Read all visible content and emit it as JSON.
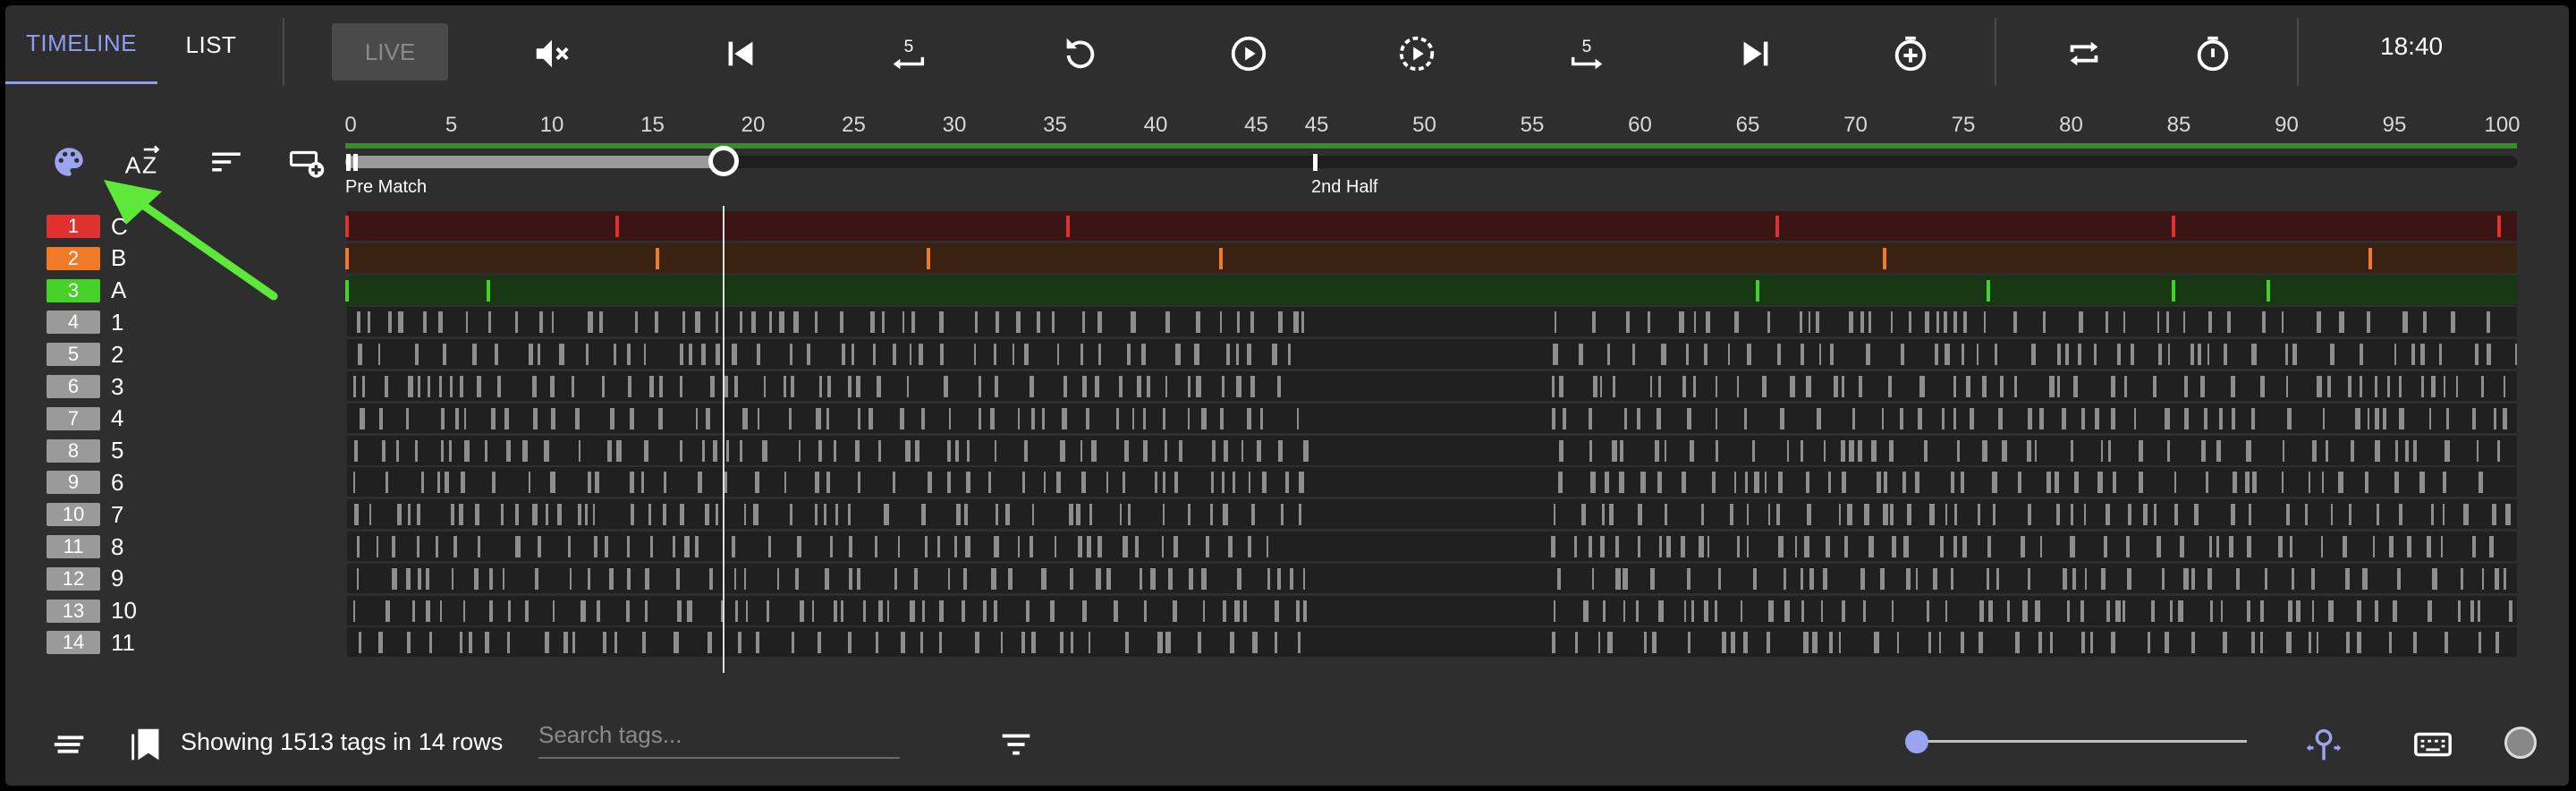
{
  "tabs": {
    "timeline": "TIMELINE",
    "list": "LIST"
  },
  "live_label": "LIVE",
  "clock": "18:40",
  "toolbar_icons": [
    "mute-icon",
    "skip-previous-icon",
    "rewind-5-icon",
    "replay-icon",
    "play-icon",
    "slow-play-icon",
    "forward-5-icon",
    "skip-next-icon",
    "add-timer-icon",
    "loop-icon",
    "timer-icon"
  ],
  "ruler": {
    "ticks_first_half": [
      "0",
      "5",
      "10",
      "15",
      "20",
      "25",
      "30",
      "35",
      "40",
      "45"
    ],
    "ticks_second_half": [
      "45",
      "50",
      "55",
      "60",
      "65",
      "70",
      "75",
      "80",
      "85",
      "90",
      "95",
      "100"
    ]
  },
  "periods": [
    "Pre Match",
    "2nd Half"
  ],
  "playhead_minute": 18.8,
  "rows": [
    {
      "num": "1",
      "name": "C",
      "color": "#e03131",
      "bg": "#3b1414"
    },
    {
      "num": "2",
      "name": "B",
      "color": "#f07a28",
      "bg": "#3a2212"
    },
    {
      "num": "3",
      "name": "A",
      "color": "#46d128",
      "bg": "#173812"
    },
    {
      "num": "4",
      "name": "1",
      "color": "#9a9a9a",
      "bg": "#202020"
    },
    {
      "num": "5",
      "name": "2",
      "color": "#9a9a9a",
      "bg": "#202020"
    },
    {
      "num": "6",
      "name": "3",
      "color": "#9a9a9a",
      "bg": "#202020"
    },
    {
      "num": "7",
      "name": "4",
      "color": "#9a9a9a",
      "bg": "#202020"
    },
    {
      "num": "8",
      "name": "5",
      "color": "#9a9a9a",
      "bg": "#202020"
    },
    {
      "num": "9",
      "name": "6",
      "color": "#9a9a9a",
      "bg": "#202020"
    },
    {
      "num": "10",
      "name": "7",
      "color": "#9a9a9a",
      "bg": "#202020"
    },
    {
      "num": "11",
      "name": "8",
      "color": "#9a9a9a",
      "bg": "#202020"
    },
    {
      "num": "12",
      "name": "9",
      "color": "#9a9a9a",
      "bg": "#202020"
    },
    {
      "num": "13",
      "name": "10",
      "color": "#9a9a9a",
      "bg": "#202020"
    },
    {
      "num": "14",
      "name": "11",
      "color": "#9a9a9a",
      "bg": "#202020"
    }
  ],
  "tag_markers": {
    "C": [
      0,
      13.4,
      35.8,
      66.2,
      84.6,
      99.7
    ],
    "B": [
      0,
      15.4,
      28.9,
      43.4,
      71.2,
      93.7
    ],
    "A": [
      0,
      7.0,
      65.3,
      76.0,
      84.6,
      89.0
    ]
  },
  "status": {
    "text": "Showing 1513 tags in 14 rows"
  },
  "search": {
    "placeholder": "Search tags..."
  },
  "zoom_level": 0.0,
  "colors": {
    "accent": "#8f9cf0",
    "annotation": "#5ee83a"
  }
}
